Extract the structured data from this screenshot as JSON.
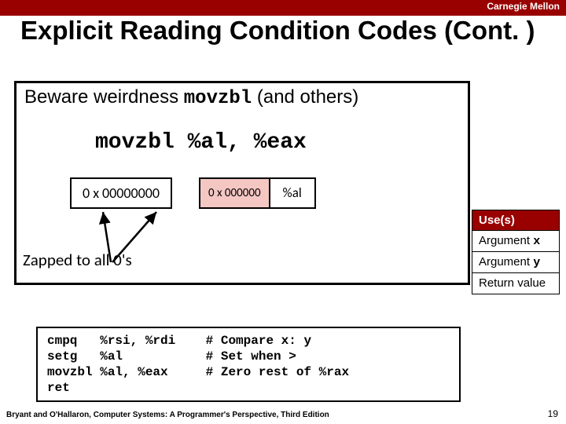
{
  "brand": "Carnegie Mellon",
  "title": "Explicit Reading Condition Codes (Cont. )",
  "sub_pre": "Beware weirdness ",
  "sub_code": "movzbl",
  "sub_post": " (and others)",
  "instr": "movzbl %al, %eax",
  "cells": {
    "c1": "0 x 00000000",
    "c2": "0 x 000000",
    "c3": "%al"
  },
  "zapped": "Zapped to all 0's",
  "rtable": {
    "head": "Use(s)",
    "rows": [
      {
        "pre": "Argument ",
        "mono": "x"
      },
      {
        "pre": "Argument ",
        "mono": "y"
      },
      {
        "pre": "Return value",
        "mono": ""
      }
    ]
  },
  "code": "cmpq   %rsi, %rdi    # Compare x: y\nsetg   %al           # Set when >\nmovzbl %al, %eax     # Zero rest of %rax\nret",
  "footer": "Bryant and O'Hallaron, Computer Systems: A Programmer's Perspective, Third Edition",
  "page": "19"
}
